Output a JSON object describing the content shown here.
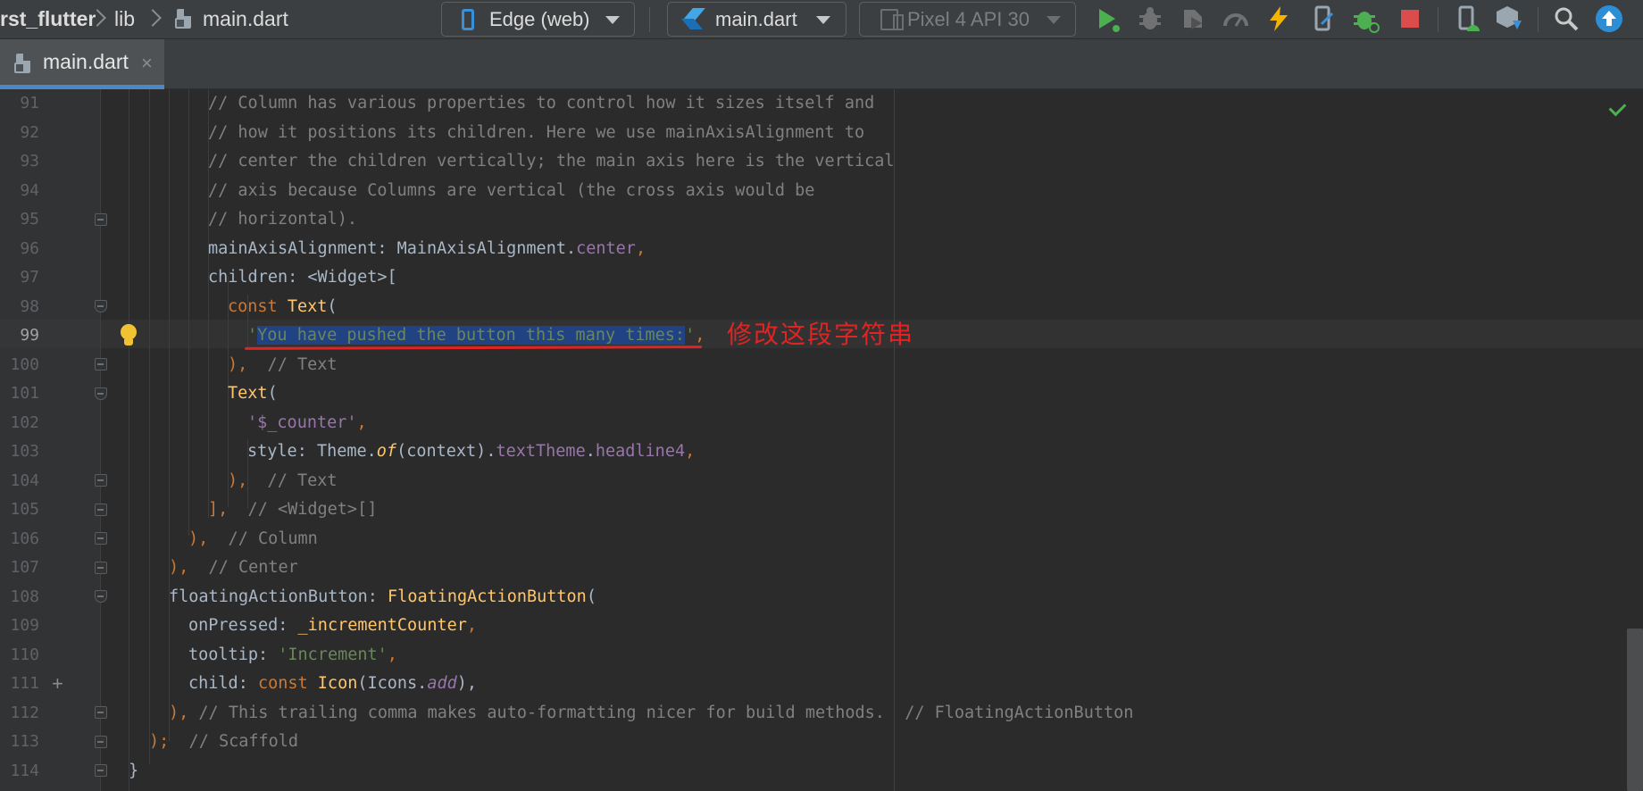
{
  "breadcrumb": {
    "project": "rst_flutter",
    "folder": "lib",
    "file": "main.dart"
  },
  "toolbar": {
    "device_selector": "Edge (web)",
    "run_config": "main.dart",
    "emulator": "Pixel 4 API 30"
  },
  "tab": {
    "label": "main.dart",
    "close": "×"
  },
  "annotation": {
    "text": "修改这段字符串"
  },
  "line_numbers": [
    "91",
    "92",
    "93",
    "94",
    "95",
    "96",
    "97",
    "98",
    "99",
    "100",
    "101",
    "102",
    "103",
    "104",
    "105",
    "106",
    "107",
    "108",
    "109",
    "110",
    "111",
    "112",
    "113",
    "114"
  ],
  "code": {
    "l91": "// Column has various properties to control how it sizes itself and",
    "l92": "// how it positions its children. Here we use mainAxisAlignment to",
    "l93": "// center the children vertically; the main axis here is the vertical",
    "l94": "// axis because Columns are vertical (the cross axis would be",
    "l95": "// horizontal).",
    "l96_a": "mainAxisAlignment: MainAxisAlignment.",
    "l96_b": "center",
    "l96_c": ",",
    "l97": "children: <Widget>[",
    "l98_a": "const ",
    "l98_b": "Text",
    "l98_c": "(",
    "l99_a": "'",
    "l99_b": "You have pushed the button this many times:",
    "l99_c": "'",
    "l99_d": ",",
    "l100_a": "),",
    "l100_b": "  // Text",
    "l101_a": "Text",
    "l101_b": "(",
    "l102_a": "'$_counter'",
    "l102_b": ",",
    "l103_a": "style: Theme.",
    "l103_b": "of",
    "l103_c": "(context).",
    "l103_d": "textTheme",
    "l103_e": ".",
    "l103_f": "headline4",
    "l103_g": ",",
    "l104_a": "),",
    "l104_b": "  // Text",
    "l105_a": "],",
    "l105_b": "  // <Widget>[]",
    "l106_a": "),",
    "l106_b": "  // Column",
    "l107_a": "),",
    "l107_b": "  // Center",
    "l108_a": "floatingActionButton: ",
    "l108_b": "FloatingActionButton",
    "l108_c": "(",
    "l109_a": "onPressed: ",
    "l109_b": "_incrementCounter",
    "l109_c": ",",
    "l110_a": "tooltip: ",
    "l110_b": "'Increment'",
    "l110_c": ",",
    "l111_a": "child: ",
    "l111_b": "const ",
    "l111_c": "Icon",
    "l111_d": "(Icons.",
    "l111_e": "add",
    "l111_f": "),",
    "l112_a": "),",
    "l112_b": " // This trailing comma makes auto-formatting nicer for build methods.  // FloatingActionButton",
    "l113_a": ");",
    "l113_b": "  // Scaffold",
    "l114": "}"
  },
  "colors": {
    "selection": "#214283",
    "annotation": "#e02424",
    "keyword": "#cc7832",
    "string": "#6a8759",
    "comment": "#808080",
    "property": "#9876aa",
    "class": "#ffc66d"
  },
  "icons": [
    "file-dart-icon",
    "phone-icon",
    "flutter-dart-icon",
    "device-icon",
    "run-icon",
    "debug-icon",
    "profile-icon",
    "coverage-icon",
    "hot-reload-icon",
    "device-manager-icon",
    "flutter-inspector-icon",
    "stop-icon",
    "avd-manager-icon",
    "sdk-manager-icon",
    "search-icon",
    "update-icon",
    "lightbulb-icon",
    "checkmark-icon",
    "fold-icon",
    "plus-icon"
  ]
}
